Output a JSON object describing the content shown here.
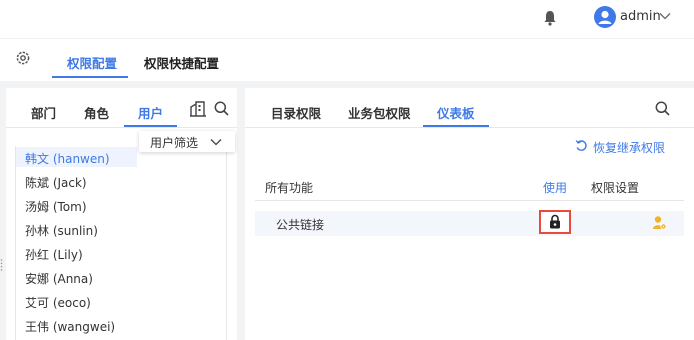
{
  "header": {
    "username": "admin"
  },
  "main_tabs": [
    "权限配置",
    "权限快捷配置"
  ],
  "left": {
    "tabs": [
      "部门",
      "角色",
      "用户"
    ],
    "filter_label": "用户筛选",
    "users": [
      "韩文 (hanwen)",
      "陈斌 (Jack)",
      "汤姆 (Tom)",
      "孙林 (sunlin)",
      "孙红 (Lily)",
      "安娜 (Anna)",
      "艾可 (eoco)",
      "王伟 (wangwei)"
    ]
  },
  "right": {
    "tabs": [
      "目录权限",
      "业务包权限",
      "仪表板"
    ],
    "restore_label": "恢复继承权限",
    "columns": [
      "所有功能",
      "使用",
      "权限设置"
    ],
    "rows": [
      {
        "name": "公共链接"
      }
    ]
  },
  "colors": {
    "accent": "#3f7ae8",
    "highlight_border": "#e84b3c",
    "warning_icon": "#f0b429"
  },
  "icons": [
    "bell-icon",
    "avatar-icon",
    "chevron-down-icon",
    "gear-icon",
    "building-icon",
    "search-icon",
    "restore-icon",
    "lock-icon",
    "user-settings-icon"
  ]
}
